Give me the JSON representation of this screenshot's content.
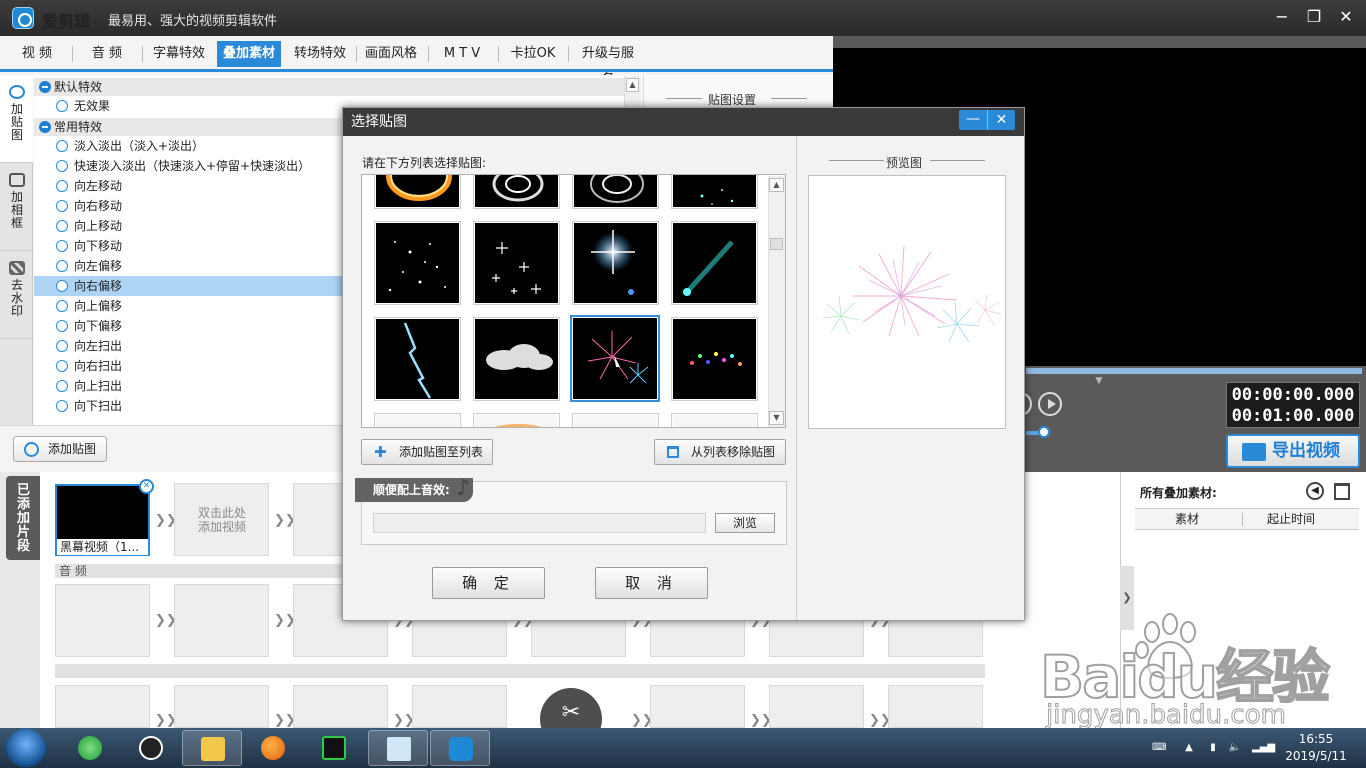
{
  "app": {
    "name": "爱剪辑",
    "slogan": "最易用、强大的视频剪辑软件",
    "window_controls": [
      "−",
      "❐",
      "✕"
    ]
  },
  "tabs": [
    {
      "label": "视 频",
      "active": false
    },
    {
      "label": "音 频",
      "active": false
    },
    {
      "label": "字幕特效",
      "active": false
    },
    {
      "label": "叠加素材",
      "active": true
    },
    {
      "label": "转场特效",
      "active": false
    },
    {
      "label": "画面风格",
      "active": false
    },
    {
      "label": "M T V",
      "active": false
    },
    {
      "label": "卡拉OK",
      "active": false
    },
    {
      "label": "升级与服务",
      "active": false
    }
  ],
  "side_tabs": [
    {
      "label": "加贴图",
      "icon": "sticker-icon",
      "active": true
    },
    {
      "label": "加相框",
      "icon": "frame-icon",
      "active": false
    },
    {
      "label": "去水印",
      "icon": "watermark-icon",
      "active": false
    }
  ],
  "effects": {
    "group_default": "默认特效",
    "item_none": "无效果",
    "group_common": "常用特效",
    "items": [
      "淡入淡出（淡入+淡出）",
      "快速淡入淡出（快速淡入+停留+快速淡出）",
      "向左移动",
      "向右移动",
      "向上移动",
      "向下移动",
      "向左偏移",
      "向右偏移",
      "向上偏移",
      "向下偏移",
      "向左扫出",
      "向右扫出",
      "向上扫出",
      "向下扫出"
    ],
    "selected": "向右偏移"
  },
  "settings_title": "贴图设置",
  "add_sticker_label": "添加贴图",
  "player": {
    "time_current": "00:00:00.000",
    "time_total": "00:01:00.000",
    "export_label": "导出视频"
  },
  "overlay_list": {
    "title": "所有叠加素材:",
    "col_material": "素材",
    "col_time": "起止时间"
  },
  "timeline": {
    "tab_label": "已添加片段",
    "first_clip_label": "黑幕视频（1...",
    "empty_clip_text_1": "双击此处",
    "empty_clip_text_2": "添加视频",
    "audio_label": "音 频"
  },
  "dialog": {
    "title": "选择贴图",
    "prompt": "请在下方列表选择贴图:",
    "preview_title": "预览图",
    "add_to_list": "添加贴图至列表",
    "remove_from_list": "从列表移除贴图",
    "music_label": "顺便配上音效:",
    "browse": "浏览",
    "ok": "确 定",
    "cancel": "取 消",
    "thumbs": [
      "fire-ring",
      "spiral-glow-1",
      "spiral-glow-2",
      "blue-sparkle-dust",
      "starfield",
      "twinkle-stars",
      "star-flare",
      "light-beam",
      "lightning",
      "cloud",
      "fireworks",
      "colorful-particles",
      "blank-1",
      "orange-fire",
      "blank-3",
      "white-burst"
    ],
    "selected_thumb": "fireworks"
  },
  "taskbar": {
    "time": "16:55",
    "date": "2019/5/11"
  },
  "watermark": {
    "main": "Baidu经验",
    "url": "jingyan.baidu.com"
  },
  "colors": {
    "accent": "#2b8ad8",
    "titlebar": "#2f2f2f",
    "selection": "#aed4f5"
  }
}
